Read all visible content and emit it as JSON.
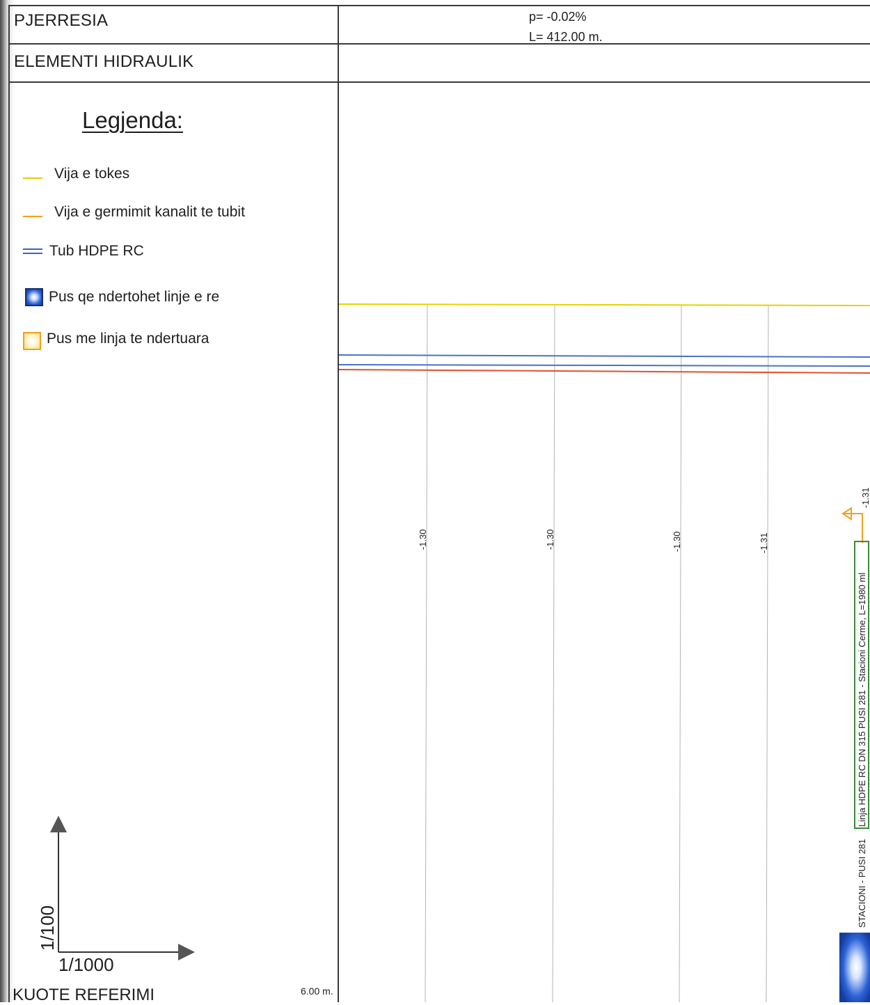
{
  "table": {
    "row1_label": "PJERRESIA",
    "row2_label": "ELEMENTI HIDRAULIK",
    "slope": "p= -0.02%",
    "length": "L= 412.00 m."
  },
  "legend": {
    "title": "Legjenda:",
    "items": [
      {
        "label": "Vija e tokes",
        "symbol": "yellow-line-icon",
        "color": "#e8c800"
      },
      {
        "label": "Vija e germimit kanalit te tubit",
        "symbol": "orange-line-icon",
        "color": "#f2a20a"
      },
      {
        "label": "Tub HDPE RC",
        "symbol": "double-blue-line-icon",
        "color": "#3b63c0"
      },
      {
        "label": "Pus qe  ndertohet linje e re",
        "symbol": "blue-well-icon",
        "color": "#1f4fc2"
      },
      {
        "label": "Pus me linja te ndertuara",
        "symbol": "orange-well-icon",
        "color": "#f0a020"
      }
    ]
  },
  "scale": {
    "vertical": "1/100",
    "horizontal": "1/1000"
  },
  "reference": {
    "label": "KUOTE REFERIMI",
    "value": "6.00 m."
  },
  "profile": {
    "ground_line_color": "#e8d200",
    "pipe_color": "#4a72c8",
    "excavation_color": "#e05030",
    "depth_labels": [
      "-1.30",
      "-1.30",
      "-1.30",
      "-1.31",
      "-1.31"
    ]
  },
  "pipe_annotation": {
    "boxed": "Linja HDPE RC DN 315  PUSI 281 - Stacioni Cerme, L=1980 ml",
    "line2": "STACIONI - PUSI 281"
  }
}
